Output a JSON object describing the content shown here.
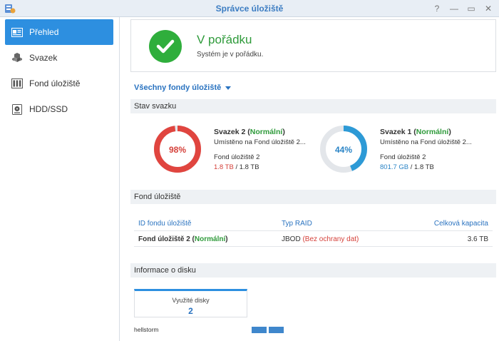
{
  "window": {
    "title": "Správce úložiště",
    "controls": [
      "?",
      "—",
      "▭",
      "✕"
    ]
  },
  "sidebar": {
    "items": [
      {
        "label": "Přehled",
        "icon": "overview-icon",
        "active": true
      },
      {
        "label": "Svazek",
        "icon": "volume-icon",
        "active": false
      },
      {
        "label": "Fond úložiště",
        "icon": "storage-pool-icon",
        "active": false
      },
      {
        "label": "HDD/SSD",
        "icon": "hdd-icon",
        "active": false
      }
    ]
  },
  "status": {
    "title": "V pořádku",
    "subtitle": "Systém je v pořádku.",
    "color": "#2fae3c"
  },
  "pool_selector": {
    "label": "Všechny fondy úložiště"
  },
  "volumes_section": {
    "title": "Stav svazku",
    "volumes": [
      {
        "name": "Svazek 2",
        "state": "Normální",
        "location": "Umístěno na Fond úložiště 2...",
        "pool": "Fond úložiště 2",
        "used": "1.8 TB",
        "total": "/ 1.8 TB",
        "percent_label": "98%",
        "percent": 98,
        "color": "#e0453f"
      },
      {
        "name": "Svazek 1",
        "state": "Normální",
        "location": "Umístěno na Fond úložiště 2...",
        "pool": "Fond úložiště 2",
        "used": "801.7 GB",
        "total": "/ 1.8 TB",
        "percent_label": "44%",
        "percent": 44,
        "color": "#2d9ad6"
      }
    ]
  },
  "pool_section": {
    "title": "Fond úložiště",
    "columns": [
      "ID fondu úložiště",
      "Typ RAID",
      "Celková kapacita"
    ],
    "rows": [
      {
        "id": "Fond úložiště 2",
        "state": "Normální",
        "raid": "JBOD",
        "raid_note": "(Bez ochrany dat)",
        "capacity": "3.6 TB"
      }
    ]
  },
  "disk_section": {
    "title": "Informace o disku",
    "used_disks_label": "Využité disky",
    "used_disks_value": "2",
    "host": "hellstorm"
  }
}
